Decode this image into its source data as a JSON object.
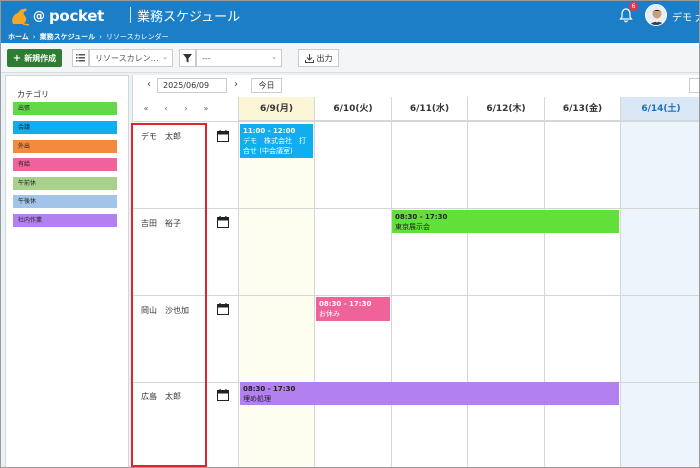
{
  "header": {
    "logo_at": "@",
    "logo_text": "pocket",
    "app_title": "業務スケジュール",
    "notification_count": "6",
    "user_name": "デモ 太"
  },
  "breadcrumb": [
    "ホーム",
    "業務スケジュール",
    "リソースカレンダー"
  ],
  "toolbar": {
    "new_label": "新規作成",
    "resource_select_value": "リソースカレン…",
    "filter_select_value": "---",
    "export_label": "出力"
  },
  "categories": {
    "title": "カテゴリ",
    "items": [
      {
        "label": "出張",
        "color": "#62d84a"
      },
      {
        "label": "会議",
        "color": "#10aef0"
      },
      {
        "label": "外出",
        "color": "#f48a3e"
      },
      {
        "label": "有給",
        "color": "#f0629a"
      },
      {
        "label": "午前休",
        "color": "#a9d18e"
      },
      {
        "label": "午後休",
        "color": "#a2c4e8"
      },
      {
        "label": "社内作業",
        "color": "#b380f0"
      }
    ]
  },
  "calendar": {
    "prev": "‹",
    "next": "›",
    "date_value": "2025/06/09",
    "today_label": "今日",
    "nav_buttons": [
      "«",
      "‹",
      "›",
      "»"
    ],
    "days": [
      "6/9(月)",
      "6/10(火)",
      "6/11(水)",
      "6/12(木)",
      "6/13(金)",
      "6/14(土)"
    ],
    "people": [
      "デモ　太郎",
      "吉田　裕子",
      "岡山　沙也加",
      "広島　太郎"
    ],
    "events": [
      {
        "time": "11:00 - 12:00",
        "text": "デモ　株式会社　打合せ (中会議室)",
        "color": "#10aef0"
      },
      {
        "time": "08:30 - 17:30",
        "text": "東京展示会",
        "color": "#62e03a"
      },
      {
        "time": "08:30 - 17:30",
        "text": "お休み",
        "color": "#f0629a"
      },
      {
        "time": "08:30 - 17:30",
        "text": "埋め処理",
        "color": "#b380f0"
      }
    ]
  }
}
